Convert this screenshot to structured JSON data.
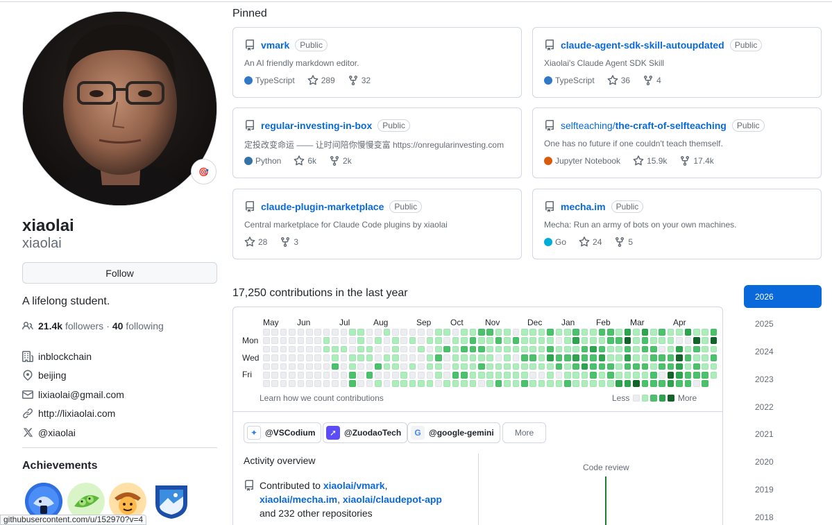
{
  "profile": {
    "name": "xiaolai",
    "login": "xiaolai",
    "follow_label": "Follow",
    "bio": "A lifelong student.",
    "followers_count": "21.4k",
    "followers_label": "followers",
    "separator": "·",
    "following_count": "40",
    "following_label": "following",
    "details": [
      {
        "icon": "organization-icon",
        "text": "inblockchain"
      },
      {
        "icon": "location-icon",
        "text": "beijing"
      },
      {
        "icon": "mail-icon",
        "text": "lixiaolai@gmail.com"
      },
      {
        "icon": "link-icon",
        "text": "http://lixiaolai.com"
      },
      {
        "icon": "x-logo-icon",
        "text": "@xiaolai"
      }
    ],
    "achievements_title": "Achievements",
    "status_url": "githubusercontent.com/u/152970?v=4"
  },
  "pinned": {
    "title": "Pinned",
    "visibility_label": "Public",
    "repos": [
      {
        "owner": "",
        "name": "vmark",
        "description": "An AI friendly markdown editor.",
        "language": "TypeScript",
        "lang_color": "#3178c6",
        "stars": "289",
        "forks": "32"
      },
      {
        "owner": "",
        "name": "claude-agent-sdk-skill-autoupdated",
        "description": "Xiaolai's Claude Agent SDK Skill",
        "language": "TypeScript",
        "lang_color": "#3178c6",
        "stars": "36",
        "forks": "4"
      },
      {
        "owner": "",
        "name": "regular-investing-in-box",
        "description": "定投改变命运 —— 让时间陪你慢慢变富 https://onregularinvesting.com",
        "language": "Python",
        "lang_color": "#3572A5",
        "stars": "6k",
        "forks": "2k"
      },
      {
        "owner": "selfteaching/",
        "name": "the-craft-of-selfteaching",
        "description": "One has no future if one couldn't teach themself.",
        "language": "Jupyter Notebook",
        "lang_color": "#DA5B0B",
        "stars": "15.9k",
        "forks": "17.4k"
      },
      {
        "owner": "",
        "name": "claude-plugin-marketplace",
        "description": "Central marketplace for Claude Code plugins by xiaolai",
        "language": "",
        "lang_color": "",
        "stars": "28",
        "forks": "3"
      },
      {
        "owner": "",
        "name": "mecha.im",
        "description": "Mecha: Run an army of bots on your own machines.",
        "language": "Go",
        "lang_color": "#00ADD8",
        "stars": "24",
        "forks": "5"
      }
    ]
  },
  "contributions": {
    "title": "17,250 contributions in the last year",
    "months": [
      "May",
      "Jun",
      "Jul",
      "Aug",
      "Sep",
      "Oct",
      "Nov",
      "Dec",
      "Jan",
      "Feb",
      "Mar",
      "Apr"
    ],
    "days": [
      "Mon",
      "Wed",
      "Fri"
    ],
    "learn_label": "Learn how we count contributions",
    "less_label": "Less",
    "more_label": "More",
    "level_colors": [
      "#ebedf0",
      "#aceebb",
      "#4ac26b",
      "#2da44e",
      "#116329"
    ],
    "orgs": [
      {
        "name": "@VSCodium",
        "icon": "vscodium-icon",
        "color": "#2f80ed"
      },
      {
        "name": "@ZuodaoTech",
        "icon": "zuodao-icon",
        "color": "#5b4cf5"
      },
      {
        "name": "@google-gemini",
        "icon": "google-icon",
        "color": "#4285f4"
      }
    ],
    "more_orgs_label": "More",
    "activity_title": "Activity overview",
    "activity_prefix": "Contributed to ",
    "activity_repo1": "xiaolai/vmark",
    "activity_repo2": "xiaolai/mecha.im",
    "activity_repo3": "xiaolai/claudepot-app",
    "activity_suffix": "and 232 other repositories",
    "code_review_label": "Code review"
  },
  "years": [
    "2026",
    "2025",
    "2024",
    "2023",
    "2022",
    "2021",
    "2020",
    "2019",
    "2018"
  ],
  "active_year": "2026"
}
